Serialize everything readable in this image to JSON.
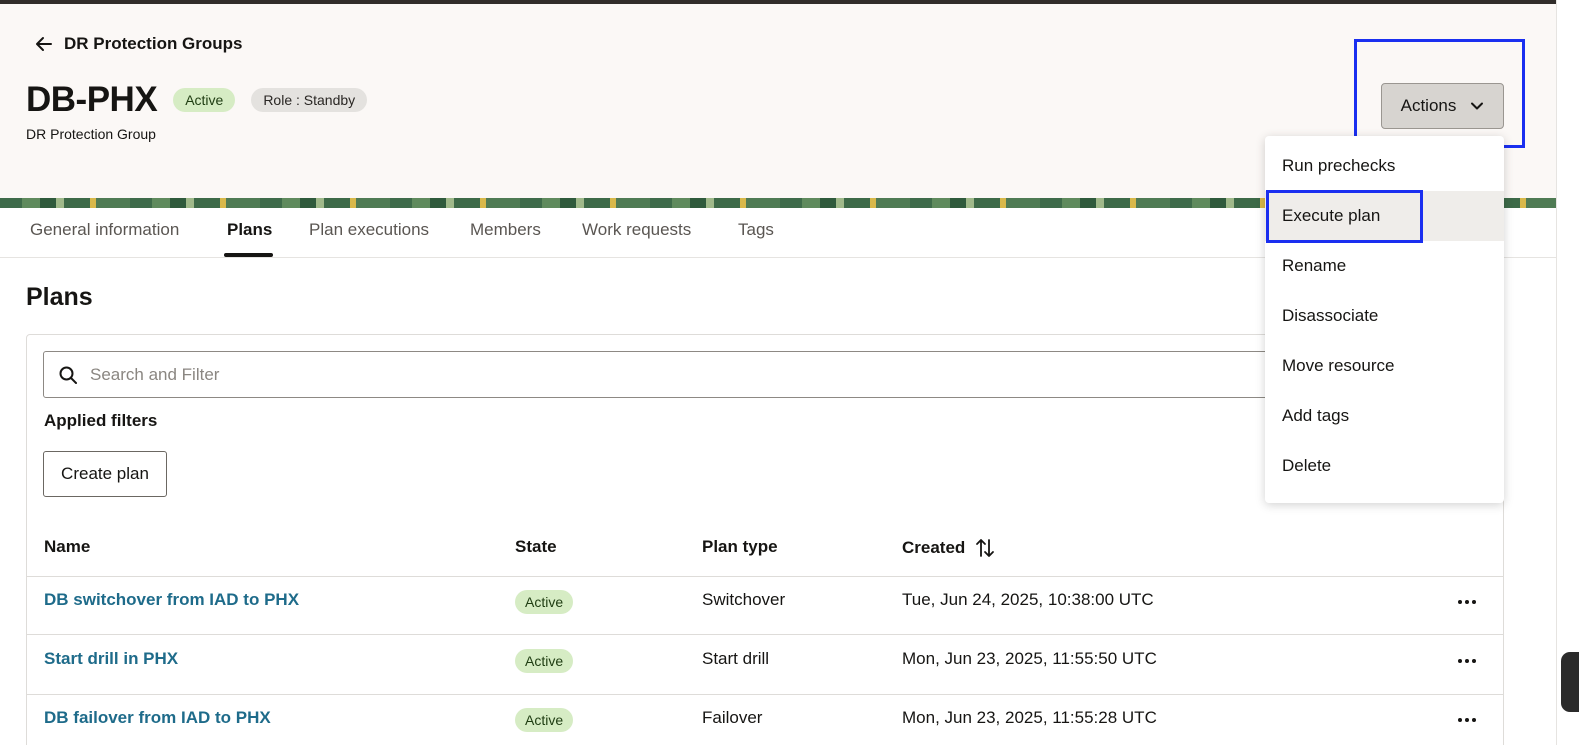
{
  "header": {
    "back_label": "DR Protection Groups",
    "title": "DB-PHX",
    "status_badge": "Active",
    "role_badge": "Role : Standby",
    "subtitle": "DR Protection Group",
    "actions_label": "Actions"
  },
  "tabs": [
    {
      "label": "General information"
    },
    {
      "label": "Plans"
    },
    {
      "label": "Plan executions"
    },
    {
      "label": "Members"
    },
    {
      "label": "Work requests"
    },
    {
      "label": "Tags"
    }
  ],
  "active_tab": "Plans",
  "section": {
    "title": "Plans",
    "search_placeholder": "Search and Filter",
    "applied_filters_label": "Applied filters",
    "create_label": "Create plan"
  },
  "table": {
    "columns": [
      "Name",
      "State",
      "Plan type",
      "Created"
    ],
    "rows": [
      {
        "name": "DB switchover from IAD to PHX",
        "state": "Active",
        "plan_type": "Switchover",
        "created": "Tue, Jun 24, 2025, 10:38:00 UTC"
      },
      {
        "name": "Start drill in PHX",
        "state": "Active",
        "plan_type": "Start drill",
        "created": "Mon, Jun 23, 2025, 11:55:50 UTC"
      },
      {
        "name": "DB failover from IAD to PHX",
        "state": "Active",
        "plan_type": "Failover",
        "created": "Mon, Jun 23, 2025, 11:55:28 UTC"
      }
    ]
  },
  "actions_menu": {
    "items": [
      {
        "label": "Run prechecks"
      },
      {
        "label": "Execute plan"
      },
      {
        "label": "Rename"
      },
      {
        "label": "Disassociate"
      },
      {
        "label": "Move resource"
      },
      {
        "label": "Add tags"
      },
      {
        "label": "Delete"
      }
    ],
    "highlighted_item": "Execute plan"
  },
  "colors": {
    "link": "#1e6b8a",
    "active_badge": "#d6ecc4",
    "focus_outline": "#1a2ff0",
    "header_bg": "#fbf8f6"
  },
  "icons": {
    "back": "arrow-left-icon",
    "actions_chevron": "chevron-down-icon",
    "search": "search-icon",
    "sort": "sort-icon",
    "row_menu": "kebab-menu-icon"
  }
}
